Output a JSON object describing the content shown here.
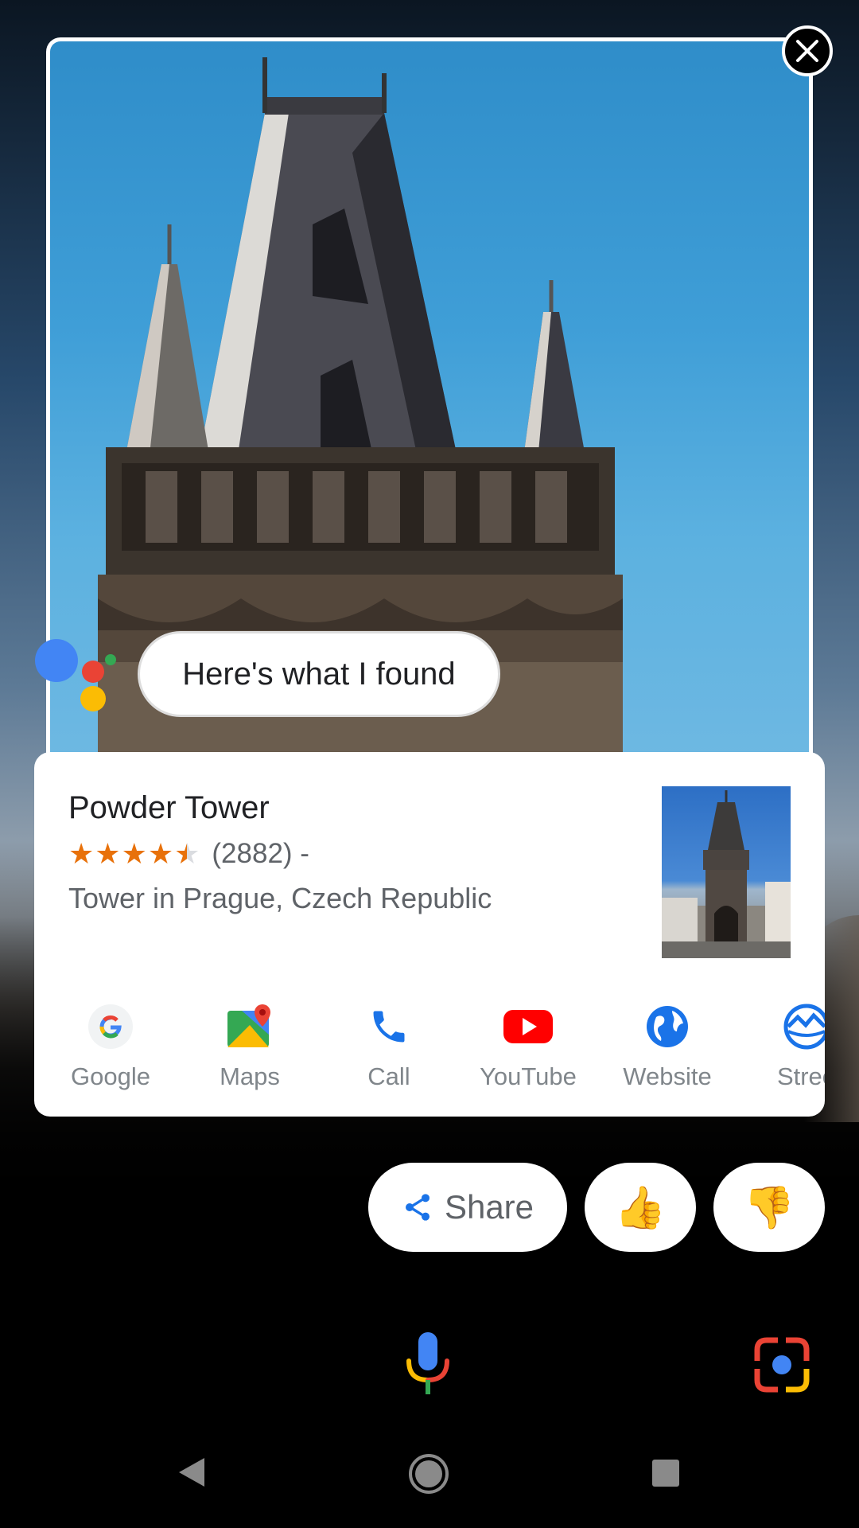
{
  "assistant": {
    "response_text": "Here's what I found"
  },
  "result_card": {
    "title": "Powder Tower",
    "rating": 4.5,
    "review_count": "(2882) -",
    "subtitle": "Tower in Prague, Czech Republic",
    "star_color": "#e8710a"
  },
  "actions": [
    {
      "label": "Google",
      "icon": "google-icon"
    },
    {
      "label": "Maps",
      "icon": "maps-icon"
    },
    {
      "label": "Call",
      "icon": "phone-icon"
    },
    {
      "label": "YouTube",
      "icon": "youtube-icon"
    },
    {
      "label": "Website",
      "icon": "globe-icon"
    },
    {
      "label": "Stree",
      "icon": "street-view-icon"
    }
  ],
  "chips": {
    "share_label": "Share",
    "thumbs_up": "👍",
    "thumbs_down": "👎"
  },
  "colors": {
    "google_blue": "#4285f4",
    "google_red": "#ea4335",
    "google_yellow": "#fbbc04",
    "google_green": "#34a853",
    "youtube_red": "#ff0000",
    "label_gray": "#80868b"
  }
}
